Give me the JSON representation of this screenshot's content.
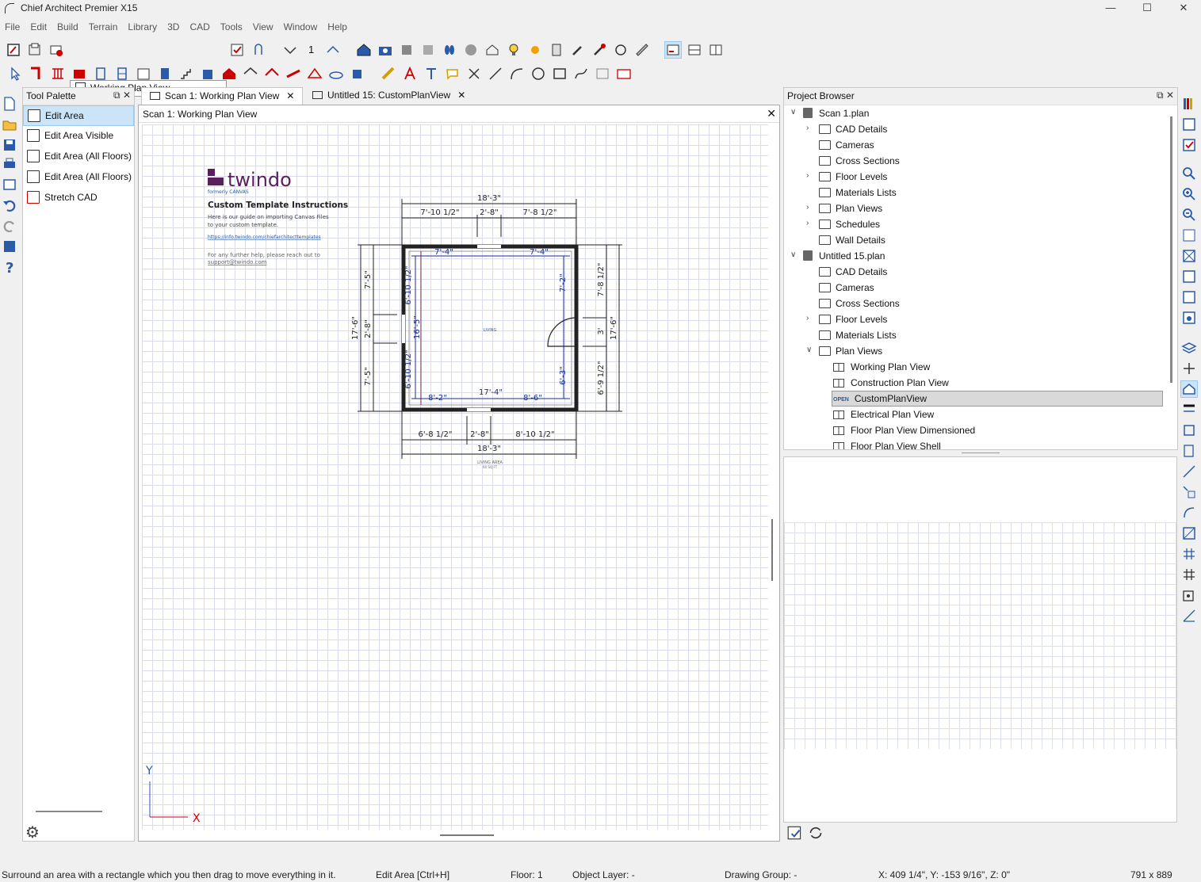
{
  "window": {
    "title": "Chief Architect Premier X15"
  },
  "menu": [
    "File",
    "Edit",
    "Build",
    "Terrain",
    "Library",
    "3D",
    "CAD",
    "Tools",
    "View",
    "Window",
    "Help"
  ],
  "toolbar": {
    "view_select": "Working Plan View",
    "floor_number": "1"
  },
  "tool_palette": {
    "title": "Tool Palette",
    "items": [
      "Edit Area",
      "Edit Area Visible",
      "Edit Area (All Floors)",
      "Edit Area (All Floors) Visible",
      "Stretch CAD"
    ]
  },
  "tabs": [
    {
      "label": "Scan 1:  Working Plan View",
      "active": true
    },
    {
      "label": "Untitled 15: CustomPlanView",
      "active": false
    }
  ],
  "viewport": {
    "title": "Scan 1:  Working Plan View",
    "template": {
      "logo": "twindo",
      "logo_sub": "formerly  CANVAS",
      "heading": "Custom Template Instructions",
      "line1": "Here is our guide on importing Canvas Files",
      "line2": "to your custom template.",
      "link": "https://info.twindo.com/chiefarchitecttemplates",
      "help1": "For any further help, please reach out to",
      "help2": "support@twindo.com"
    },
    "plan": {
      "room_label": "LIVING",
      "area_label": "LIVING AREA",
      "area_sub": "XX SQ FT",
      "dims": {
        "top_total": "18'-3\"",
        "top_a": "7'-10 1/2\"",
        "top_b": "2'-8\"",
        "top_c": "7'-8 1/2\"",
        "in_top_l": "7'-4\"",
        "in_top_r": "7'-4\"",
        "bot_total": "18'-3\"",
        "bot_a": "6'-8 1/2\"",
        "bot_b": "2'-8\"",
        "bot_c": "8'-10 1/2\"",
        "in_bot": "17'-4\"",
        "in_bot_l": "8'-2\"",
        "in_bot_r": "8'-6\"",
        "left_total": "17'-6\"",
        "left_a": "7'-5\"",
        "left_b": "2'-8\"",
        "left_c": "7'-5\"",
        "in_left_a": "6'-10 1/2\"",
        "in_left_b": "6'-10 1/2\"",
        "in_left_mid": "16'-5\"",
        "right_total": "17'-6\"",
        "right_a": "7'-8 1/2\"",
        "right_b": "3'",
        "right_c": "6'-9 1/2\"",
        "in_right_a": "7'-2\"",
        "in_right_b": "6'-3\""
      },
      "axis_y": "Y",
      "axis_x": "X"
    }
  },
  "project_browser": {
    "title": "Project Browser",
    "tree": [
      {
        "label": "Scan 1.plan",
        "level": 0,
        "kind": "plan",
        "caret": "down"
      },
      {
        "label": "CAD Details",
        "level": 1,
        "kind": "folder",
        "caret": "right"
      },
      {
        "label": "Cameras",
        "level": 1,
        "kind": "folder",
        "caret": ""
      },
      {
        "label": "Cross Sections",
        "level": 1,
        "kind": "folder",
        "caret": ""
      },
      {
        "label": "Floor Levels",
        "level": 1,
        "kind": "folder",
        "caret": "right"
      },
      {
        "label": "Materials Lists",
        "level": 1,
        "kind": "folder",
        "caret": ""
      },
      {
        "label": "Plan Views",
        "level": 1,
        "kind": "folder",
        "caret": "right"
      },
      {
        "label": "Schedules",
        "level": 1,
        "kind": "folder",
        "caret": "right"
      },
      {
        "label": "Wall Details",
        "level": 1,
        "kind": "folder",
        "caret": ""
      },
      {
        "label": "Untitled 15.plan",
        "level": 0,
        "kind": "plan",
        "caret": "down"
      },
      {
        "label": "CAD Details",
        "level": 1,
        "kind": "folder",
        "caret": ""
      },
      {
        "label": "Cameras",
        "level": 1,
        "kind": "folder",
        "caret": ""
      },
      {
        "label": "Cross Sections",
        "level": 1,
        "kind": "folder",
        "caret": ""
      },
      {
        "label": "Floor Levels",
        "level": 1,
        "kind": "folder",
        "caret": "right"
      },
      {
        "label": "Materials Lists",
        "level": 1,
        "kind": "folder",
        "caret": ""
      },
      {
        "label": "Plan Views",
        "level": 1,
        "kind": "folder",
        "caret": "down"
      },
      {
        "label": "Working Plan View",
        "level": 2,
        "kind": "view",
        "caret": ""
      },
      {
        "label": "Construction Plan View",
        "level": 2,
        "kind": "view",
        "caret": ""
      },
      {
        "label": "CustomPlanView",
        "level": 2,
        "kind": "open",
        "caret": "",
        "selected": true
      },
      {
        "label": "Electrical Plan View",
        "level": 2,
        "kind": "view",
        "caret": ""
      },
      {
        "label": "Floor Plan View Dimensioned",
        "level": 2,
        "kind": "view",
        "caret": ""
      },
      {
        "label": "Floor Plan View Shell",
        "level": 2,
        "kind": "view",
        "caret": ""
      }
    ],
    "open_badge": "OPEN"
  },
  "status": {
    "hint": "Surround an area with a rectangle which you then drag to move everything in it.",
    "tool": "Edit Area [Ctrl+H]",
    "floor": "Floor: 1",
    "layer": "Object Layer: -",
    "group": "Drawing Group: -",
    "coords": "X: 409 1/4\", Y: -153 9/16\", Z: 0\"",
    "size": "791 x 889"
  },
  "colors": {
    "accent": "#cce4f7",
    "dim_blue": "#1a2f8a",
    "twindo_purple": "#5b1f5f",
    "grid": "#d8dcec"
  }
}
